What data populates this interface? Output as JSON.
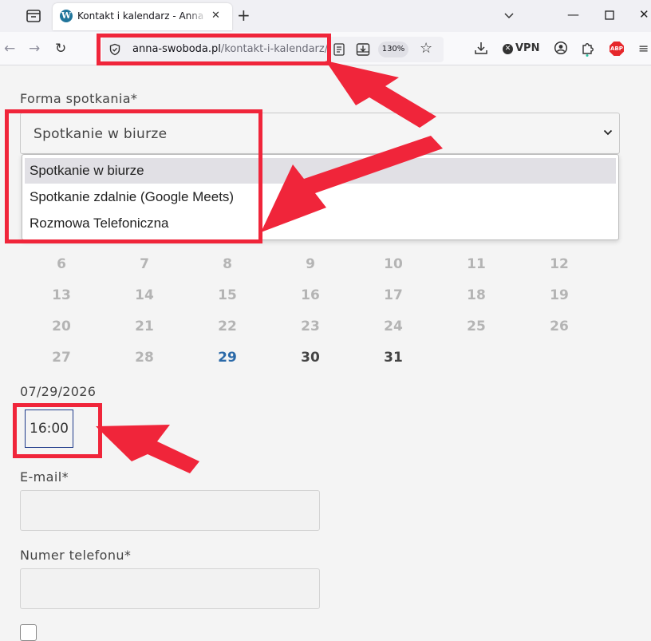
{
  "browser": {
    "tab_title": "Kontakt i kalendarz - Anna Swoboda",
    "url_host": "anna-swoboda.pl",
    "url_path": "/kontakt-i-kalendarz/",
    "zoom": "130%",
    "vpn_label": "VPN",
    "abp_label": "ABP",
    "icons": [
      "tab-list-icon",
      "wordpress-icon",
      "close-icon",
      "plus-icon",
      "chevron-down-icon",
      "minimize-icon",
      "maximize-icon",
      "close-window-icon",
      "back-icon",
      "forward-icon",
      "reload-icon",
      "shield-icon",
      "reader-view-icon",
      "pocket-icon",
      "star-icon",
      "download-icon",
      "account-icon",
      "extensions-icon",
      "menu-icon"
    ]
  },
  "form": {
    "meeting_label": "Forma spotkania*",
    "meeting_selected": "Spotkanie w biurze",
    "meeting_options": [
      "Spotkanie w biurze",
      "Spotkanie zdalnie (Google Meets)",
      "Rozmowa Telefoniczna"
    ],
    "calendar_rows": [
      [
        "6",
        "7",
        "8",
        "9",
        "10",
        "11",
        "12"
      ],
      [
        "13",
        "14",
        "15",
        "16",
        "17",
        "18",
        "19"
      ],
      [
        "20",
        "21",
        "22",
        "23",
        "24",
        "25",
        "26"
      ],
      [
        "27",
        "28",
        "29",
        "30",
        "31"
      ]
    ],
    "today": "29",
    "available_days": [
      "30",
      "31"
    ],
    "selected_date": "07/29/2026",
    "time_slot": "16:00",
    "email_label": "E-mail*",
    "phone_label": "Numer telefonu*"
  },
  "colors": {
    "annotation": "#f0253a",
    "today": "#2a69a8",
    "slot_border": "#1e3a8a"
  }
}
